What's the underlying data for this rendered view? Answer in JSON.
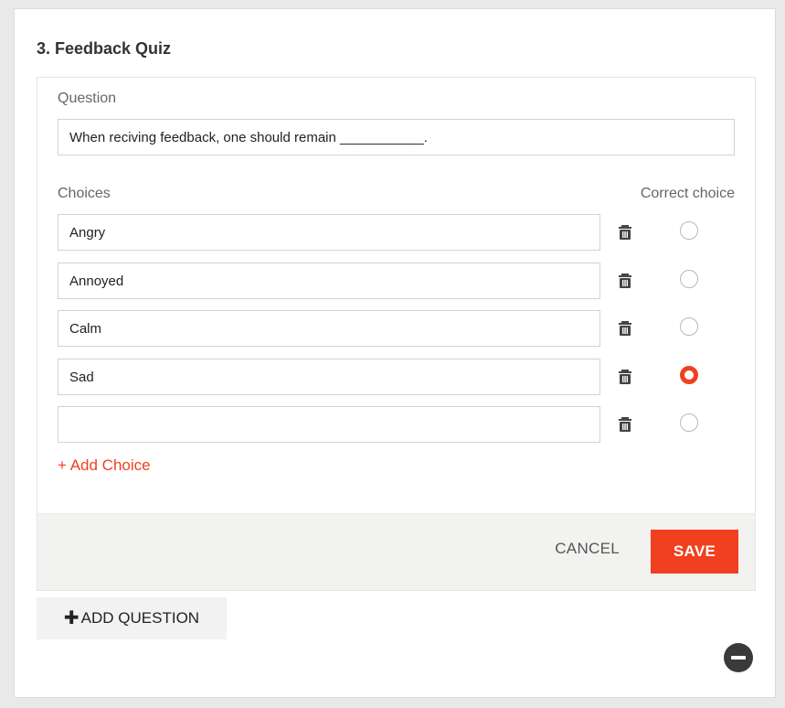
{
  "quiz": {
    "title": "3. Feedback Quiz"
  },
  "question": {
    "label": "Question",
    "value": "When reciving feedback, one should remain ___________."
  },
  "choices": {
    "label": "Choices",
    "correct_label": "Correct choice",
    "items": [
      {
        "value": "Angry",
        "correct": false
      },
      {
        "value": "Annoyed",
        "correct": false
      },
      {
        "value": "Calm",
        "correct": false
      },
      {
        "value": "Sad",
        "correct": true
      },
      {
        "value": "",
        "correct": false
      }
    ],
    "add_label": "+ Add Choice"
  },
  "actions": {
    "cancel_label": "CANCEL",
    "save_label": "SAVE"
  },
  "add_question": {
    "label": "ADD QUESTION"
  },
  "colors": {
    "accent": "#f0401f",
    "footer": "#f2f2f0"
  }
}
